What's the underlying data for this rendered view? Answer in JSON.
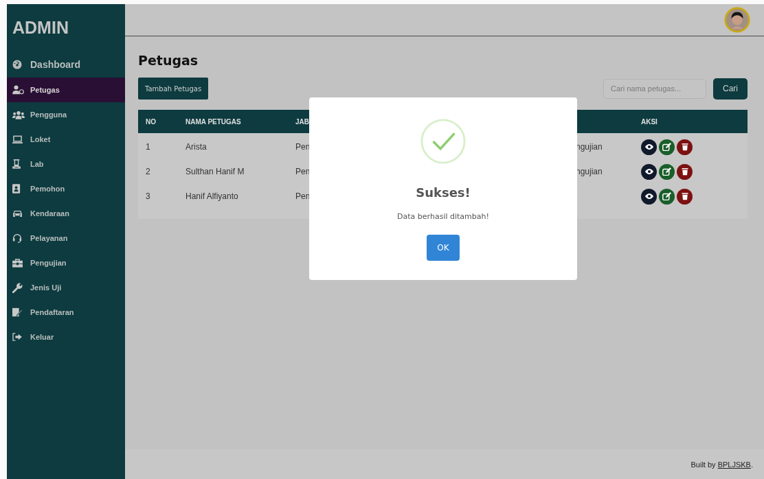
{
  "sidebar": {
    "brand": "ADMIN",
    "items": [
      {
        "label": "Dashboard",
        "kind": "gauge",
        "selected": false
      },
      {
        "label": "Petugas",
        "kind": "staff",
        "selected": true
      },
      {
        "label": "Pengguna",
        "kind": "users",
        "selected": false
      },
      {
        "label": "Loket",
        "kind": "laptop",
        "selected": false
      },
      {
        "label": "Lab",
        "kind": "flask",
        "selected": false
      },
      {
        "label": "Pemohon",
        "kind": "contact",
        "selected": false
      },
      {
        "label": "Kendaraan",
        "kind": "car",
        "selected": false
      },
      {
        "label": "Pelayanan",
        "kind": "headset",
        "selected": false
      },
      {
        "label": "Pengujian",
        "kind": "toolbox",
        "selected": false
      },
      {
        "label": "Jenis Uji",
        "kind": "wrench",
        "selected": false
      },
      {
        "label": "Pendaftaran",
        "kind": "signature",
        "selected": false
      },
      {
        "label": "Keluar",
        "kind": "logout",
        "selected": false
      }
    ]
  },
  "page": {
    "title": "Petugas",
    "add_button": "Tambah Petugas",
    "search": {
      "placeholder": "Cari nama petugas..."
    },
    "search_button": "Cari"
  },
  "table": {
    "columns": [
      "NO",
      "NAMA PETUGAS",
      "JAB",
      "",
      "AKSI"
    ],
    "rows": [
      {
        "cells": [
          "1",
          "Arista",
          "Pen",
          "ngujian"
        ]
      },
      {
        "cells": [
          "2",
          "Sulthan Hanif M",
          "Pen",
          "ngujian"
        ]
      },
      {
        "cells": [
          "3",
          "Hanif Alfiyanto",
          "Pen",
          ""
        ]
      }
    ],
    "row_actions": [
      {
        "kind": "view"
      },
      {
        "kind": "edit"
      },
      {
        "kind": "delete"
      }
    ]
  },
  "dialog": {
    "title": "Sukses!",
    "message": "Data berhasil ditambah!",
    "button": "OK"
  },
  "footer": {
    "text": "Built by ",
    "link": "BPLJSKB",
    "suffix": "."
  }
}
